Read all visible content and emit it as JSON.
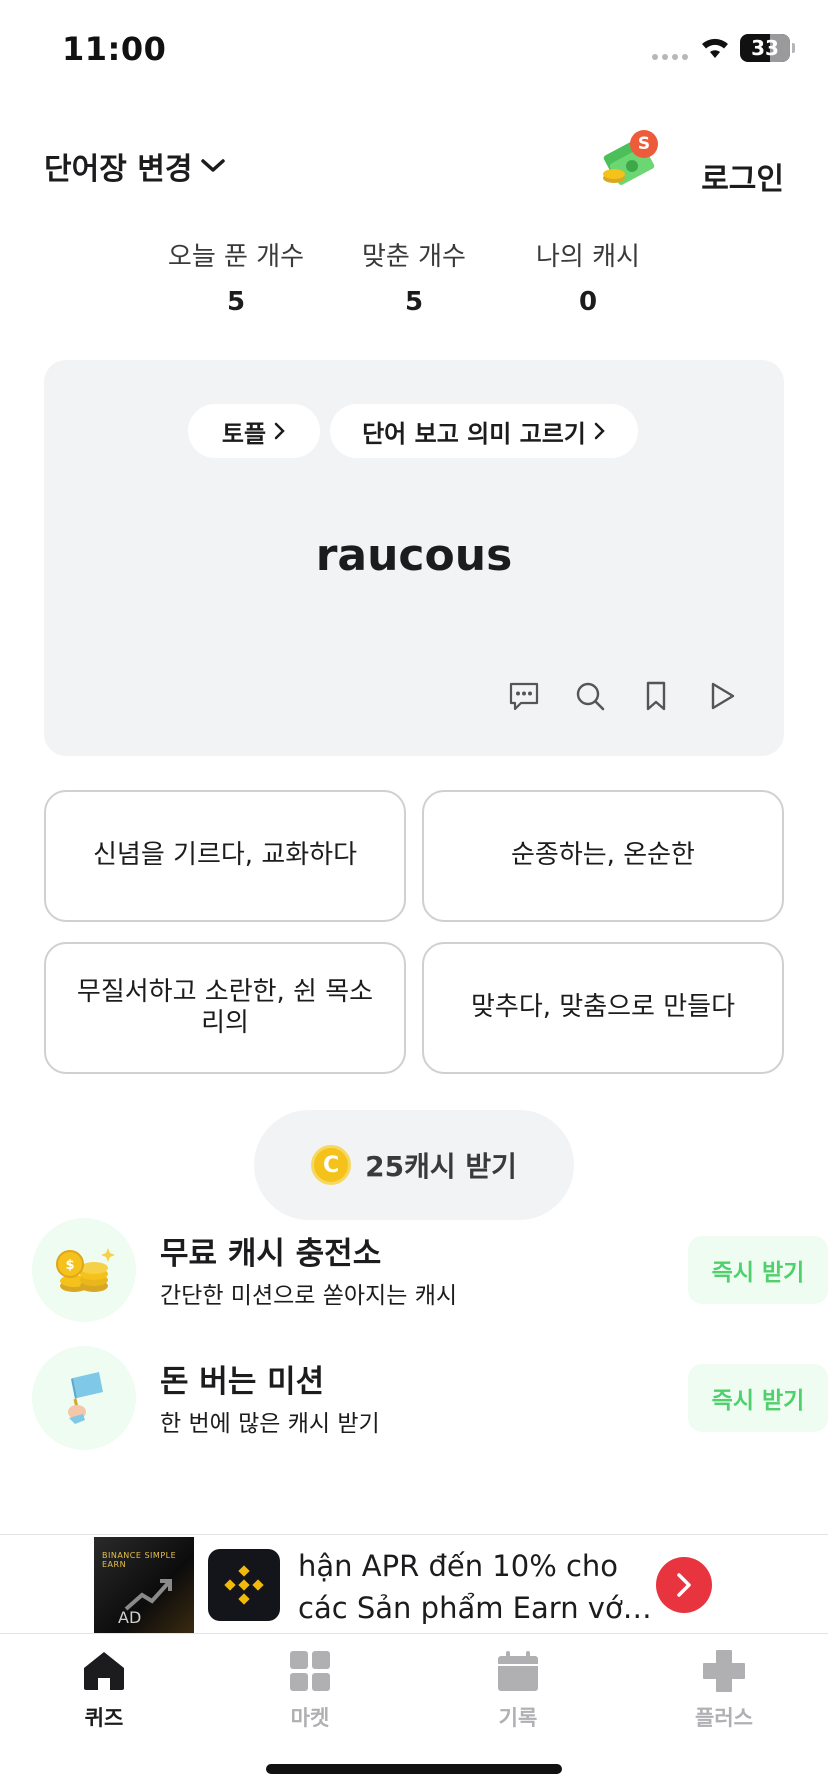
{
  "status_bar": {
    "time": "11:00",
    "battery": "33"
  },
  "header": {
    "wordbook_label": "단어장 변경",
    "cash_badge": "S",
    "login_label": "로그인"
  },
  "stats": [
    {
      "label": "오늘 푼 개수",
      "value": "5"
    },
    {
      "label": "맞춘 개수",
      "value": "5"
    },
    {
      "label": "나의 캐시",
      "value": "0"
    }
  ],
  "quiz": {
    "category_chip": "토플",
    "mode_chip": "단어 보고 의미 고르기",
    "word": "raucous",
    "tools": [
      "comment-icon",
      "search-icon",
      "bookmark-icon",
      "play-icon"
    ],
    "options": [
      "신념을 기르다, 교화하다",
      "순종하는, 온순한",
      "무질서하고 소란한, 쉰 목소리의",
      "맞추다, 맞춤으로 만들다"
    ]
  },
  "reward": {
    "coin_symbol": "C",
    "label": "25캐시 받기"
  },
  "promos": [
    {
      "icon": "coins-icon",
      "title": "무료 캐시 충전소",
      "subtitle": "간단한 미션으로 쏟아지는 캐시",
      "button": "즉시 받기"
    },
    {
      "icon": "flag-icon",
      "title": "돈 버는 미션",
      "subtitle": "한 번에 많은 캐시 받기",
      "button": "즉시 받기"
    }
  ],
  "ad": {
    "image_brand": "BINANCE SIMPLE EARN",
    "image_tag": "AD",
    "text": "hận APR đến 10% cho các Sản phẩm Earn vớ…"
  },
  "tabbar": [
    {
      "icon": "home-icon",
      "label": "퀴즈",
      "active": true
    },
    {
      "icon": "grid-icon",
      "label": "마켓",
      "active": false
    },
    {
      "icon": "calendar-icon",
      "label": "기록",
      "active": false
    },
    {
      "icon": "plus-icon",
      "label": "플러스",
      "active": false
    }
  ],
  "colors": {
    "accent_green": "#4fd06c",
    "badge_red": "#ee5b3b",
    "ad_cta_red": "#e8343f",
    "card_bg": "#f2f3f5",
    "inactive_tab": "#b0b0b3"
  }
}
